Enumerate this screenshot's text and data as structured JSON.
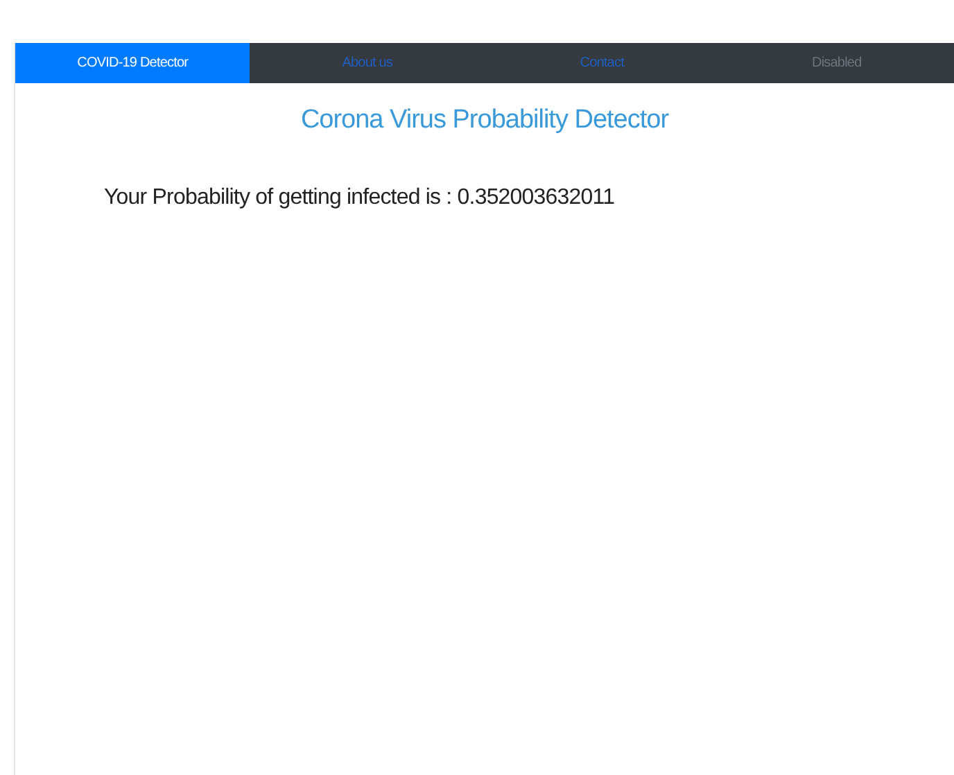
{
  "nav": {
    "items": [
      {
        "label": "COVID-19 Detector",
        "selected": true,
        "disabled": false
      },
      {
        "label": "About us",
        "selected": false,
        "disabled": false
      },
      {
        "label": "Contact",
        "selected": false,
        "disabled": false
      },
      {
        "label": "Disabled",
        "selected": false,
        "disabled": true
      }
    ]
  },
  "title": "Corona Virus Probability Detector",
  "result": "Your Probability of getting infected is : 0.352003632011"
}
